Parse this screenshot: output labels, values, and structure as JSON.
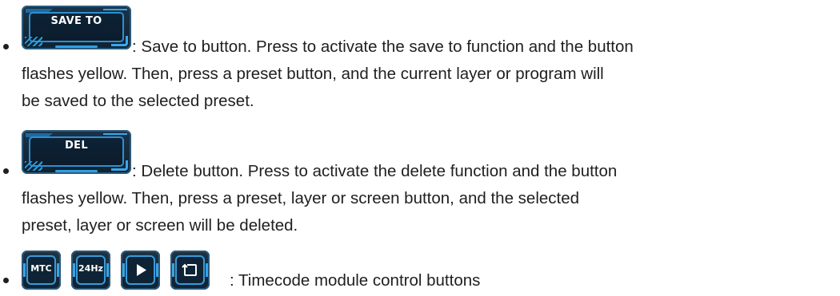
{
  "items": [
    {
      "button_label": "SAVE TO",
      "lines": [
        ": Save to button. Press to activate the save to function and the button",
        "flashes yellow. Then, press a preset button, and the current layer or program will",
        "be saved to the selected preset."
      ]
    },
    {
      "button_label": "DEL",
      "lines": [
        ": Delete button. Press to activate the delete function and the button",
        "flashes yellow. Then, press a preset, layer or screen button, and the selected",
        "preset, layer or screen will be deleted."
      ]
    },
    {
      "buttons": [
        {
          "label": "MTC",
          "icon": "text"
        },
        {
          "label": "24Hz",
          "icon": "text"
        },
        {
          "label": "",
          "icon": "play-icon"
        },
        {
          "label": "",
          "icon": "return-icon"
        }
      ],
      "lines": [
        ": Timecode module control buttons"
      ]
    }
  ],
  "colors": {
    "text": "#1f1f1f",
    "button_bg": "#0f2232",
    "button_accent": "#2f8fd0"
  }
}
